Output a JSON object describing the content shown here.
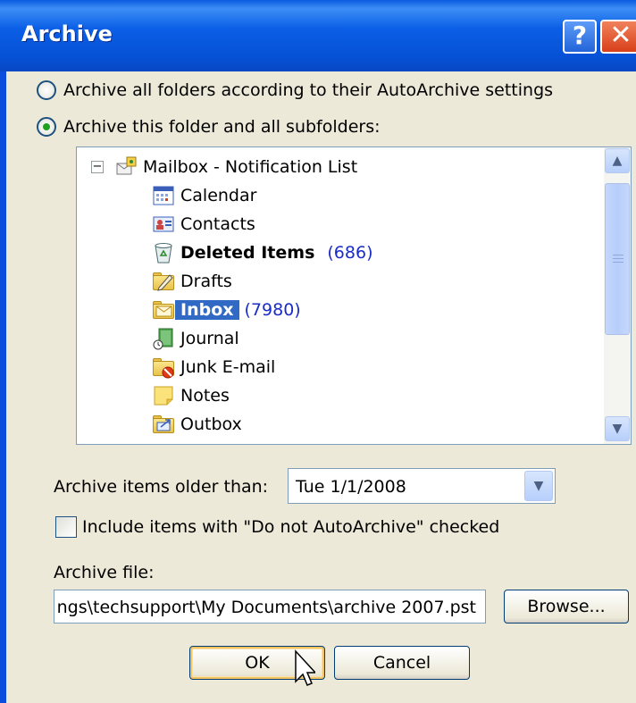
{
  "window": {
    "title": "Archive",
    "help_glyph": "?",
    "close_glyph": "✕"
  },
  "options": {
    "archive_all_label": "Archive all folders according to their AutoArchive settings",
    "archive_this_label": "Archive this folder and all subfolders:",
    "selected": "archive_this"
  },
  "tree": {
    "root": "Mailbox - Notification List",
    "items": [
      {
        "label": "Calendar",
        "icon": "calendar-icon"
      },
      {
        "label": "Contacts",
        "icon": "contacts-icon"
      },
      {
        "label": "Deleted Items",
        "count": "(686)",
        "icon": "deleted-items-icon",
        "bold": true
      },
      {
        "label": "Drafts",
        "icon": "drafts-icon"
      },
      {
        "label": "Inbox",
        "count": "(7980)",
        "icon": "inbox-icon",
        "bold": true,
        "selected": true
      },
      {
        "label": "Journal",
        "icon": "journal-icon"
      },
      {
        "label": "Junk E-mail",
        "icon": "junk-email-icon"
      },
      {
        "label": "Notes",
        "icon": "notes-icon"
      },
      {
        "label": "Outbox",
        "icon": "outbox-icon"
      }
    ],
    "collapse_glyph": "−"
  },
  "older_than": {
    "label": "Archive items older than:",
    "value": "Tue 1/1/2008"
  },
  "include_checkbox": {
    "label": "Include items with \"Do not AutoArchive\" checked",
    "checked": false
  },
  "archive_file": {
    "label": "Archive file:",
    "value": "ngs\\techsupport\\My Documents\\archive 2007.pst"
  },
  "buttons": {
    "browse": "Browse...",
    "ok": "OK",
    "cancel": "Cancel"
  },
  "colors": {
    "titlebar": "#0a5ae0",
    "selection": "#316ac5",
    "count": "#1a2cc8",
    "dialog_bg": "#ece9d8"
  }
}
